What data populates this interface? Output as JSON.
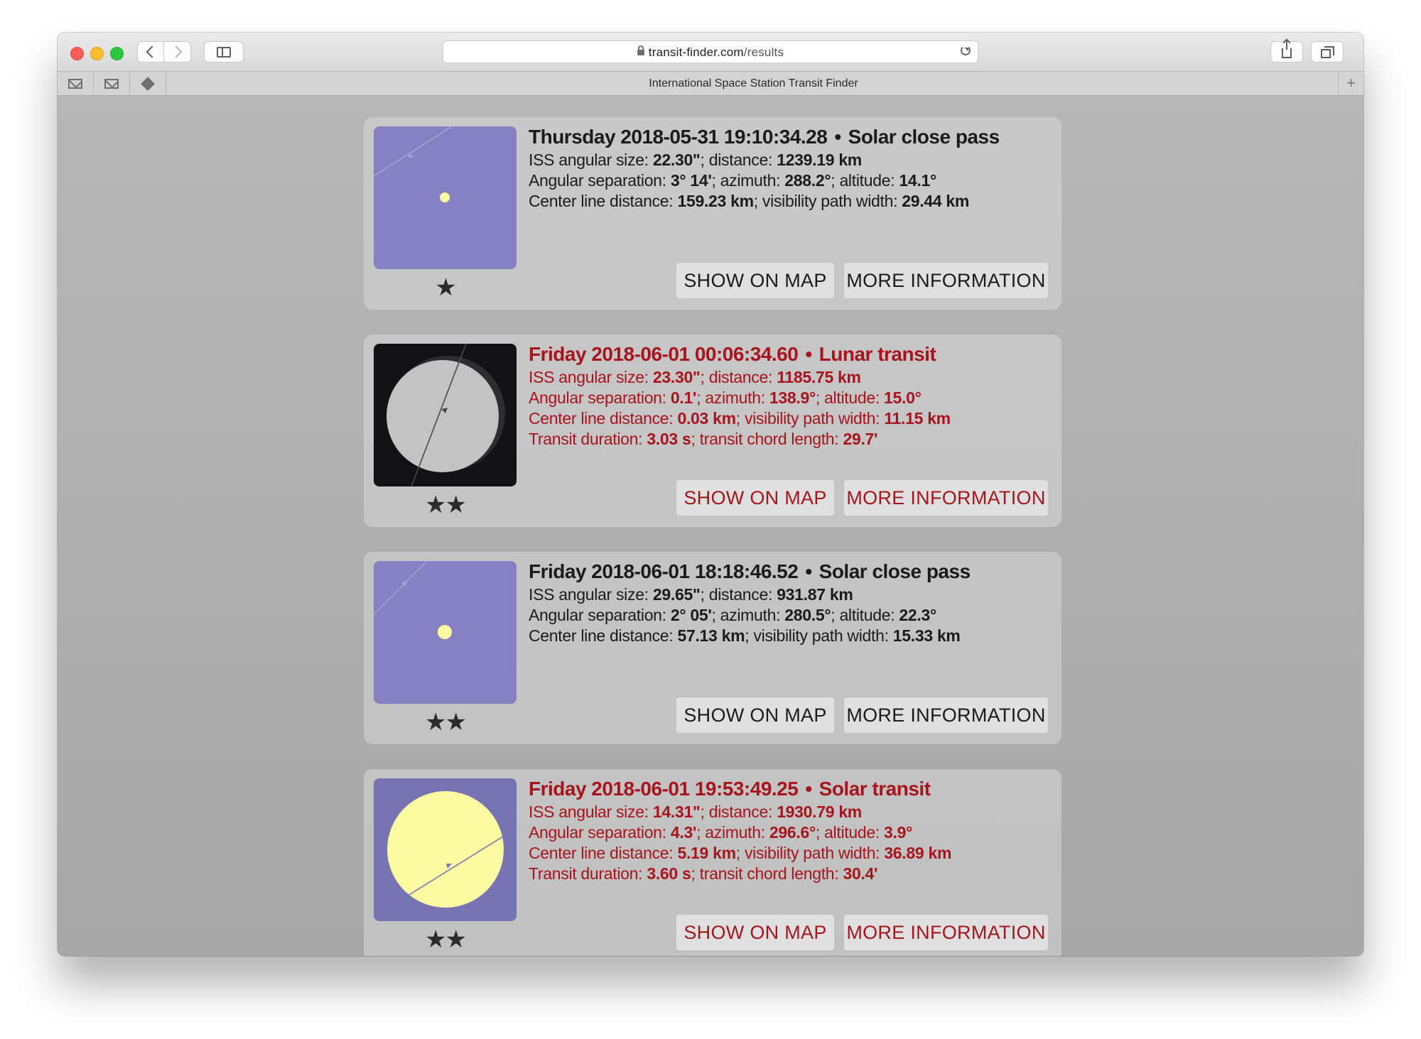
{
  "browser": {
    "url_host": "transit-finder.com",
    "url_path": "/results",
    "tab_title": "International Space Station Transit Finder"
  },
  "colors": {
    "normal_text": "#1b1b1b",
    "highlight_text": "#a8141e",
    "solar_background": "#8581c2",
    "lunar_background": "#111116",
    "sun_color": "#fdfba2",
    "moon_color": "#c3c3c3"
  },
  "results": [
    {
      "kind": "solar-close-pass",
      "highlight": false,
      "stars": "★",
      "datetime": "Thursday 2018-05-31 19:10:34.28",
      "event_type": "Solar close pass",
      "line1": {
        "l1": "ISS angular size: ",
        "v1": "22.30\"",
        "l2": "; distance: ",
        "v2": "1239.19 km"
      },
      "line2": {
        "l1": "Angular separation: ",
        "v1": "3° 14'",
        "l2": "; azimuth: ",
        "v2": "288.2°",
        "l3": "; altitude: ",
        "v3": "14.1°"
      },
      "line3": {
        "l1": "Center line distance: ",
        "v1": "159.23 km",
        "l2": "; visibility path width: ",
        "v2": "29.44 km"
      },
      "line4": null,
      "show_on_map": "SHOW ON MAP",
      "more_information": "MORE INFORMATION"
    },
    {
      "kind": "lunar-transit",
      "highlight": true,
      "stars": "★★",
      "datetime": "Friday 2018-06-01 00:06:34.60",
      "event_type": "Lunar transit",
      "line1": {
        "l1": "ISS angular size: ",
        "v1": "23.30\"",
        "l2": "; distance: ",
        "v2": "1185.75 km"
      },
      "line2": {
        "l1": "Angular separation: ",
        "v1": "0.1'",
        "l2": "; azimuth: ",
        "v2": "138.9°",
        "l3": "; altitude: ",
        "v3": "15.0°"
      },
      "line3": {
        "l1": "Center line distance: ",
        "v1": "0.03 km",
        "l2": "; visibility path width: ",
        "v2": "11.15 km"
      },
      "line4": {
        "l1": "Transit duration: ",
        "v1": "3.03 s",
        "l2": "; transit chord length: ",
        "v2": "29.7'"
      },
      "show_on_map": "SHOW ON MAP",
      "more_information": "MORE INFORMATION"
    },
    {
      "kind": "solar-close-pass",
      "highlight": false,
      "stars": "★★",
      "datetime": "Friday 2018-06-01 18:18:46.52",
      "event_type": "Solar close pass",
      "line1": {
        "l1": "ISS angular size: ",
        "v1": "29.65\"",
        "l2": "; distance: ",
        "v2": "931.87 km"
      },
      "line2": {
        "l1": "Angular separation: ",
        "v1": "2° 05'",
        "l2": "; azimuth: ",
        "v2": "280.5°",
        "l3": "; altitude: ",
        "v3": "22.3°"
      },
      "line3": {
        "l1": "Center line distance: ",
        "v1": "57.13 km",
        "l2": "; visibility path width: ",
        "v2": "15.33 km"
      },
      "line4": null,
      "show_on_map": "SHOW ON MAP",
      "more_information": "MORE INFORMATION"
    },
    {
      "kind": "solar-transit",
      "highlight": true,
      "stars": "★★",
      "datetime": "Friday 2018-06-01 19:53:49.25",
      "event_type": "Solar transit",
      "line1": {
        "l1": "ISS angular size: ",
        "v1": "14.31\"",
        "l2": "; distance: ",
        "v2": "1930.79 km"
      },
      "line2": {
        "l1": "Angular separation: ",
        "v1": "4.3'",
        "l2": "; azimuth: ",
        "v2": "296.6°",
        "l3": "; altitude: ",
        "v3": "3.9°"
      },
      "line3": {
        "l1": "Center line distance: ",
        "v1": "5.19 km",
        "l2": "; visibility path width: ",
        "v2": "36.89 km"
      },
      "line4": {
        "l1": "Transit duration: ",
        "v1": "3.60 s",
        "l2": "; transit chord length: ",
        "v2": "30.4'"
      },
      "show_on_map": "SHOW ON MAP",
      "more_information": "MORE INFORMATION"
    }
  ]
}
